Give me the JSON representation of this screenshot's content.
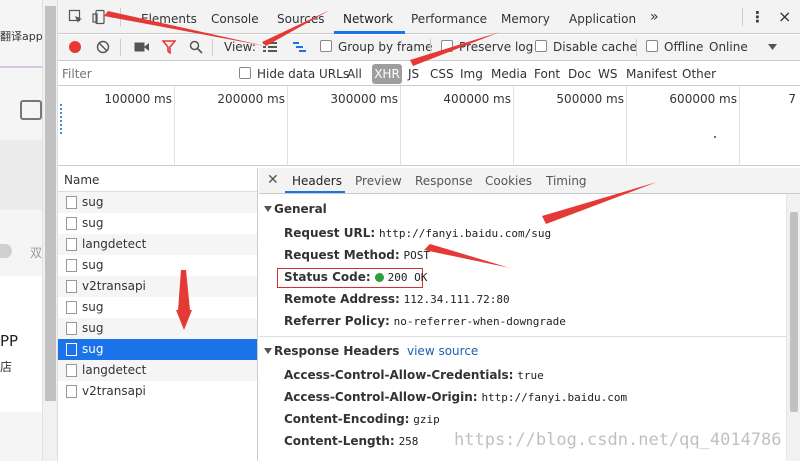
{
  "page": {
    "top_text": "翻译app",
    "shuang": "双",
    "app_text": "PP",
    "dian_text": "店"
  },
  "devtools": {
    "tabs": [
      "Elements",
      "Console",
      "Sources",
      "Network",
      "Performance",
      "Memory",
      "Application"
    ],
    "active_tab": "Network",
    "more_tabs": "»",
    "menu": "⋮",
    "close": "×"
  },
  "toolbar": {
    "view_label": "View:",
    "group_by_frame": "Group by frame",
    "preserve_log": "Preserve log",
    "disable_cache": "Disable cache",
    "offline": "Offline",
    "online": "Online"
  },
  "filter": {
    "placeholder": "Filter",
    "hide_data_urls": "Hide data URLs",
    "types": [
      "All",
      "XHR",
      "JS",
      "CSS",
      "Img",
      "Media",
      "Font",
      "Doc",
      "WS",
      "Manifest",
      "Other"
    ],
    "active_type": "XHR"
  },
  "overview": {
    "ticks": [
      "100000 ms",
      "200000 ms",
      "300000 ms",
      "400000 ms",
      "500000 ms",
      "600000 ms",
      "7"
    ]
  },
  "requests": {
    "header": "Name",
    "rows": [
      "sug",
      "sug",
      "langdetect",
      "sug",
      "v2transapi",
      "sug",
      "sug",
      "sug",
      "langdetect",
      "v2transapi"
    ],
    "selected_index": 7
  },
  "details": {
    "tabs": [
      "Headers",
      "Preview",
      "Response",
      "Cookies",
      "Timing"
    ],
    "active_tab": "Headers",
    "general_title": "General",
    "general": [
      {
        "key": "Request URL:",
        "value": "http://fanyi.baidu.com/sug"
      },
      {
        "key": "Request Method:",
        "value": "POST"
      },
      {
        "key": "Status Code:",
        "value": "200 OK"
      },
      {
        "key": "Remote Address:",
        "value": "112.34.111.72:80"
      },
      {
        "key": "Referrer Policy:",
        "value": "no-referrer-when-downgrade"
      }
    ],
    "response_title": "Response Headers",
    "view_source": "view source",
    "response": [
      {
        "key": "Access-Control-Allow-Credentials:",
        "value": "true"
      },
      {
        "key": "Access-Control-Allow-Origin:",
        "value": "http://fanyi.baidu.com"
      },
      {
        "key": "Content-Encoding:",
        "value": "gzip"
      },
      {
        "key": "Content-Length:",
        "value": "258"
      }
    ]
  },
  "watermark": "https://blog.csdn.net/qq_4014786",
  "colors": {
    "accent": "#1a73e8",
    "annotation_red": "#e53935",
    "status_green": "#2e9e3a"
  }
}
